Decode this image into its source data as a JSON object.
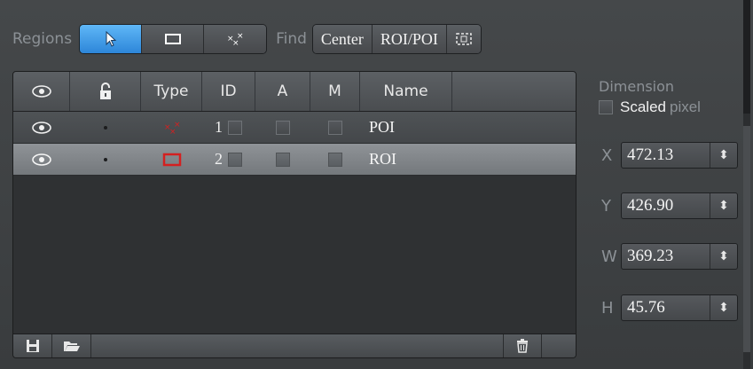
{
  "toolbar": {
    "regions_label": "Regions",
    "find_label": "Find",
    "center_label": "Center",
    "roi_poi_label": "ROI/POI",
    "tools": [
      {
        "icon": "arrow-pointer-icon",
        "active": true
      },
      {
        "icon": "rectangle-icon",
        "active": false
      },
      {
        "icon": "points-icon",
        "active": false
      }
    ]
  },
  "table": {
    "headers": {
      "visible": "eye-icon",
      "lock": "lock-icon",
      "type": "Type",
      "id": "ID",
      "a": "A",
      "m": "M",
      "name": "Name"
    },
    "rows": [
      {
        "type_icon": "points-icon",
        "id": "1",
        "name": "POI"
      },
      {
        "type_icon": "rectangle-icon",
        "id": "2",
        "name": "ROI"
      }
    ],
    "footer_icons": [
      "save-icon",
      "folder-open-icon",
      "trash-icon"
    ]
  },
  "dimension": {
    "label": "Dimension",
    "scaled_label": "Scaled",
    "pixel_label": "pixel",
    "fields": [
      {
        "label": "X",
        "value": "472.13"
      },
      {
        "label": "Y",
        "value": "426.90"
      },
      {
        "label": "W",
        "value": "369.23"
      },
      {
        "label": "H",
        "value": "45.76"
      }
    ]
  },
  "colors": {
    "accent_blue": "#3a93e4",
    "roi_red": "#d42020",
    "selected_row": "#808488"
  }
}
